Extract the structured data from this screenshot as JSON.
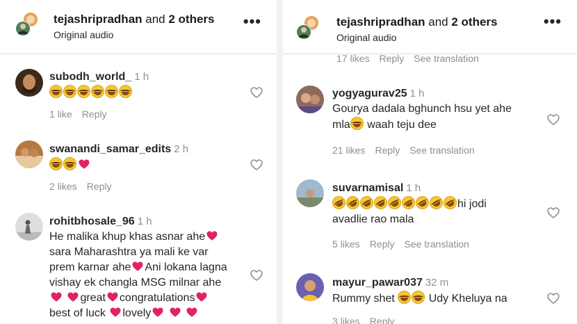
{
  "left": {
    "header": {
      "user": "tejashripradhan",
      "and_text": " and ",
      "others": "2 others",
      "audio": "Original audio",
      "more": "•••"
    },
    "comments": [
      {
        "user": "subodh_world_",
        "time": "1 h",
        "likes": "1 like",
        "reply": "Reply"
      },
      {
        "user": "swanandi_samar_edits",
        "time": "2 h",
        "likes": "2 likes",
        "reply": "Reply"
      },
      {
        "user": "rohitbhosale_96",
        "time": "1 h",
        "line1": "He malika khup khas asnar ahe",
        "line2": "sara Maharashtra ya mali ke var",
        "line3a": "prem karnar ahe",
        "line3b": "Ani lokana lagna",
        "line4": "vishay ek changla MSG milnar ahe",
        "w_great": "great",
        "w_congrats": "congratulations",
        "w_best": "best of luck ",
        "w_lovely": "lovely"
      }
    ]
  },
  "right": {
    "header": {
      "user": "tejashripradhan",
      "and_text": " and ",
      "others": "2 others",
      "audio": "Original audio",
      "more": "•••"
    },
    "partial_meta": [
      "17 likes",
      "Reply",
      "See translation"
    ],
    "comments": [
      {
        "user": "yogyagurav25",
        "time": "1 h",
        "line1": "Gourya dadala bghunch hsu yet ahe",
        "line2a": "mla",
        "line2b": " waah teju dee",
        "likes": "21 likes",
        "reply": "Reply",
        "translate": "See translation"
      },
      {
        "user": "suvarnamisal",
        "time": "1 h",
        "line1": "hi jodi",
        "line2": "avadlie rao mala",
        "likes": "5 likes",
        "reply": "Reply",
        "translate": "See translation"
      },
      {
        "user": "mayur_pawar037",
        "time": "32 m",
        "line1a": "Rummy shet ",
        "line1b": " Udy Kheluya na",
        "likes": "3 likes",
        "reply": "Reply"
      }
    ]
  },
  "icons": {
    "emoji_laugh": "face-with-tears-of-joy",
    "emoji_rofl": "rolling-on-the-floor-laughing",
    "emoji_heart": "red-heart",
    "like": "heart-outline-icon",
    "more": "more-horizontal-icon"
  },
  "colors": {
    "heart": "#e0245e",
    "muted": "#8e8e8e",
    "text": "#262626"
  }
}
